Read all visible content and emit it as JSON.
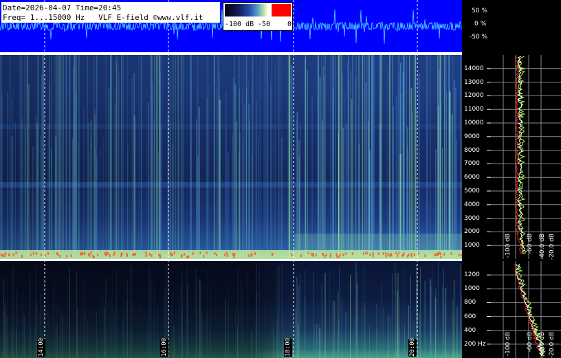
{
  "info": {
    "line1": "Date=2026-04-07 Time=20:45",
    "line2": "Freq= 1...15000 Hz   VLF E-field ©www.vlf.it"
  },
  "colorbar": {
    "label_min": "-100 dB",
    "label_mid": "-50",
    "label_max": "0"
  },
  "waveform_axis": [
    "50 %",
    "0 %",
    "-50 %"
  ],
  "time_axis": [
    "14:00",
    "16:00",
    "18:00",
    "20:00"
  ],
  "freq_axis_upper": [
    "14000",
    "13000",
    "12000",
    "11000",
    "10000",
    "9000",
    "8000",
    "7000",
    "6000",
    "5000",
    "4000",
    "3000",
    "2000",
    "1000"
  ],
  "freq_axis_lower": [
    "1200",
    "1000",
    "800",
    "600",
    "400",
    "200 Hz"
  ],
  "db_axis_upper": [
    "-100 dB",
    "-60 dB",
    "-40.0 dB",
    "-20.0 dB"
  ],
  "db_axis_lower": [
    "-100 dB",
    "-60 dB",
    "-40.0 dB",
    "-20.0 dB"
  ],
  "colors": {
    "waveform_bg": "#0000ff",
    "waveform_trace": "#4fd8ff",
    "spectrum_trace_red": "#ff2020",
    "spectrum_trace_green": "#b0ff40",
    "spectrum_trace_white": "#ffffff"
  },
  "chart_data": {
    "type": "heatmap",
    "title": "VLF E-field",
    "x_ticks": [
      "14:00",
      "16:00",
      "18:00",
      "20:00"
    ],
    "y_range_upper": [
      0,
      15000
    ],
    "y_range_lower": [
      0,
      1400
    ],
    "colorbar_range_db": [
      -100,
      0
    ]
  }
}
